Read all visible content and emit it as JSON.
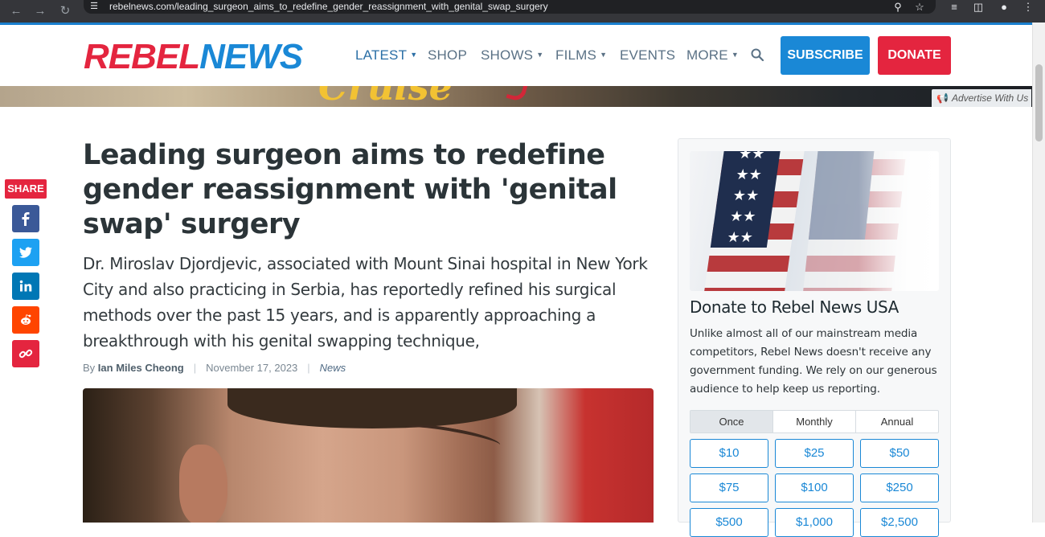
{
  "browser": {
    "url": "rebelnews.com/leading_surgeon_aims_to_redefine_gender_reassignment_with_genital_swap_surgery",
    "icons": [
      "back-icon",
      "forward-icon",
      "reload-icon",
      "site-settings-icon",
      "zoom-icon",
      "bookmark-star-icon",
      "media-controls-icon",
      "side-panel-icon",
      "profile-icon",
      "menu-icon"
    ]
  },
  "header": {
    "logo_rebel": "REBEL",
    "logo_news": "NEWS",
    "nav": [
      {
        "label": "LATEST",
        "has_caret": true
      },
      {
        "label": "SHOP",
        "has_caret": false
      },
      {
        "label": "SHOWS",
        "has_caret": true
      },
      {
        "label": "FILMS",
        "has_caret": true
      },
      {
        "label": "EVENTS",
        "has_caret": false
      },
      {
        "label": "MORE",
        "has_caret": true
      }
    ],
    "subscribe_label": "SUBSCRIBE",
    "donate_label": "DONATE",
    "colors": {
      "brand_red": "#e4253f",
      "brand_blue": "#1a88d6"
    }
  },
  "banner": {
    "ad_text": "Cruise",
    "advertise_label": "Advertise With Us"
  },
  "share": {
    "label": "SHARE",
    "buttons": [
      {
        "name": "facebook",
        "icon": "facebook-icon",
        "color": "#3b5998"
      },
      {
        "name": "twitter",
        "icon": "twitter-icon",
        "color": "#1da1f2"
      },
      {
        "name": "linkedin",
        "icon": "linkedin-icon",
        "color": "#0077b5"
      },
      {
        "name": "reddit",
        "icon": "reddit-icon",
        "color": "#ff4500"
      },
      {
        "name": "copy-link",
        "icon": "link-icon",
        "color": "#e4253f"
      }
    ]
  },
  "article": {
    "headline": "Leading surgeon aims to redefine gender reassignment with 'genital swap' surgery",
    "dek": "Dr. Miroslav Djordjevic, associated with Mount Sinai hospital in New York City and also practicing in Serbia, has reportedly refined his surgical methods over the past 15 years, and is apparently approaching a breakthrough with his genital swapping technique,",
    "by_prefix": "By",
    "author": "Ian Miles Cheong",
    "separator": "|",
    "date": "November 17, 2023",
    "category": "News"
  },
  "sidebar": {
    "title": "Donate to Rebel News USA",
    "text": "Unlike almost all of our mainstream media competitors, Rebel News doesn't receive any government funding. We rely on our generous audience to help keep us reporting.",
    "frequencies": [
      "Once",
      "Monthly",
      "Annual"
    ],
    "selected_frequency": "Once",
    "amounts": [
      "$10",
      "$25",
      "$50",
      "$75",
      "$100",
      "$250",
      "$500",
      "$1,000",
      "$2,500"
    ]
  }
}
